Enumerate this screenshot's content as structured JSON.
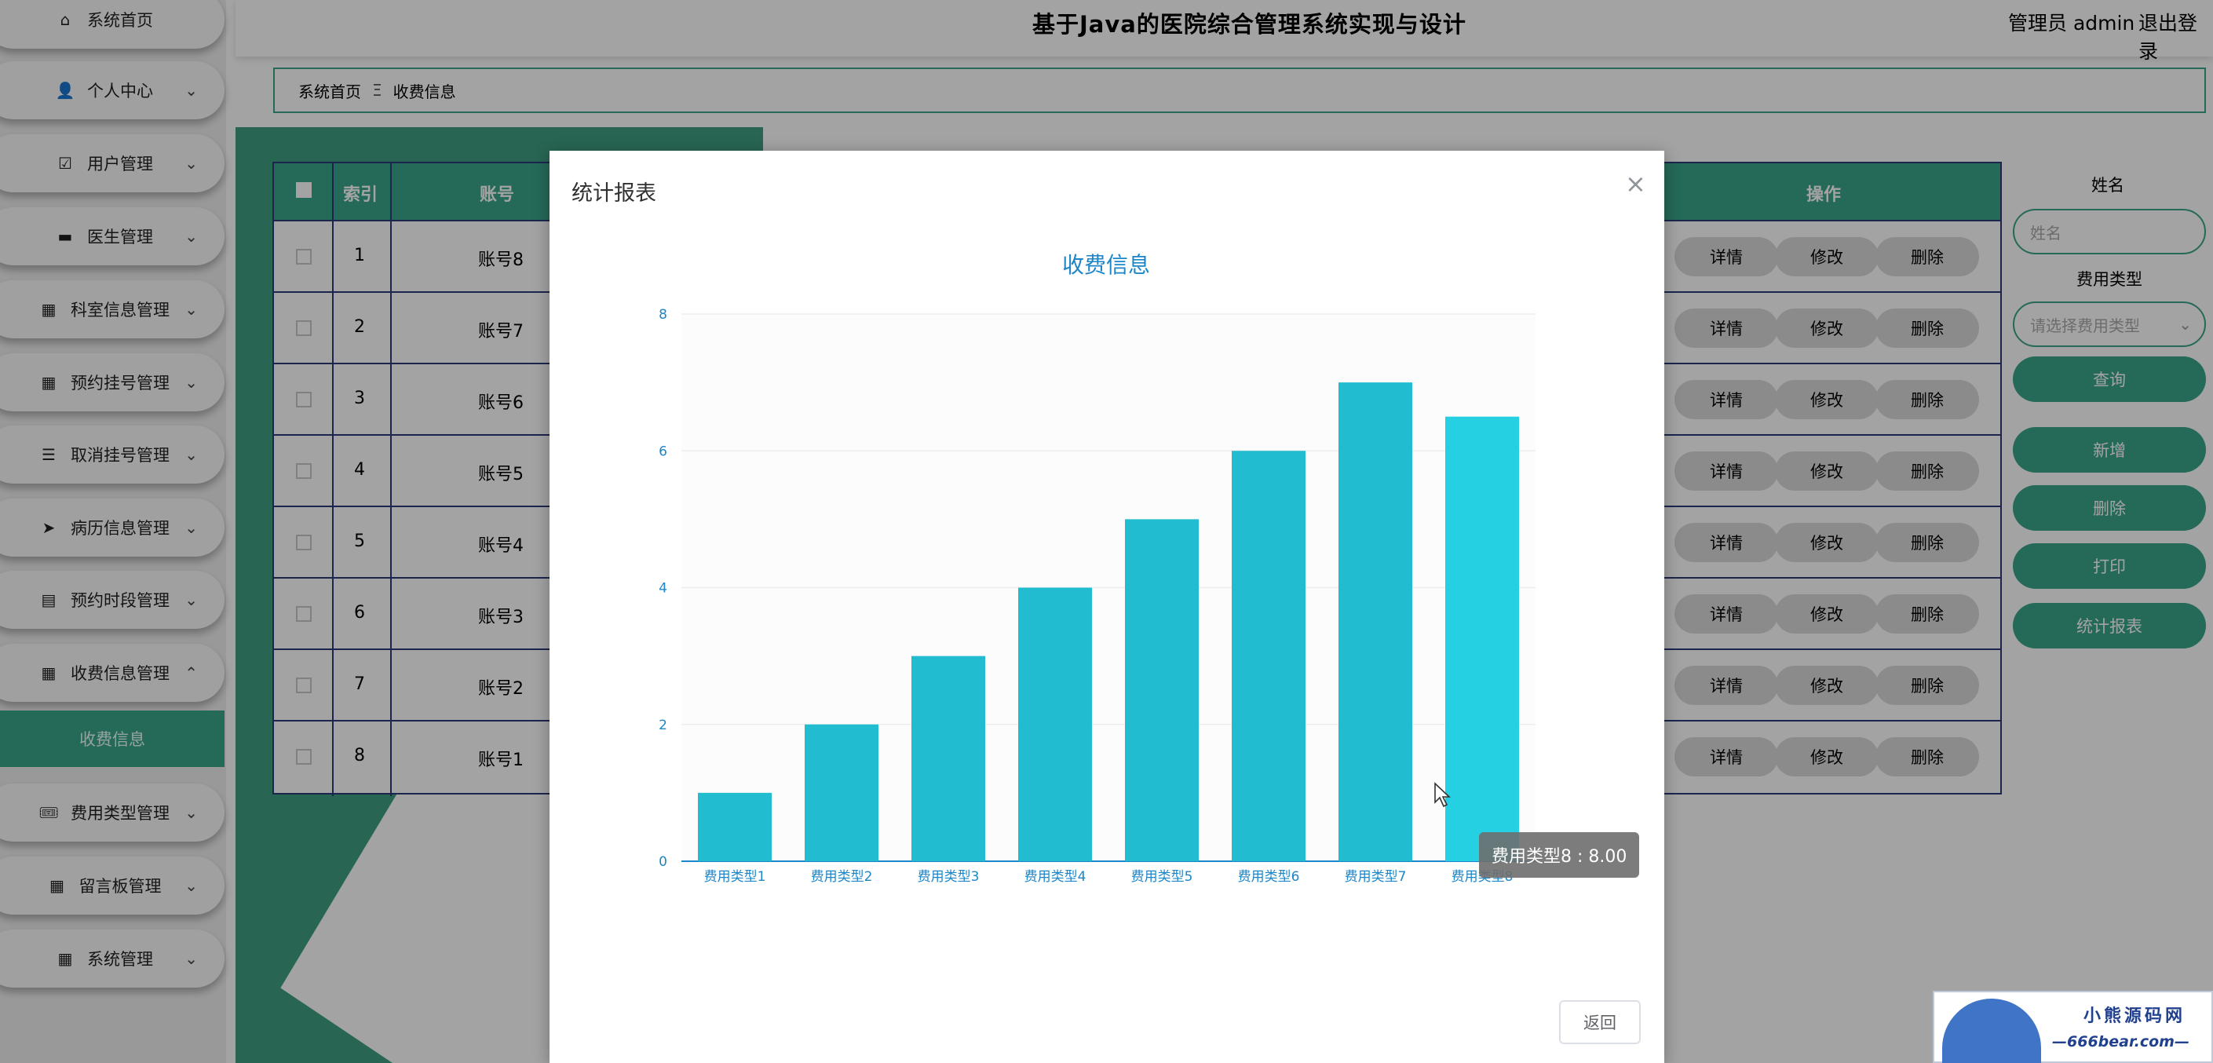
{
  "app": {
    "title": "基于Java的医院综合管理系统实现与设计",
    "user": "管理员 admin",
    "logout": "退出登录"
  },
  "sidebar": {
    "items": [
      {
        "label": "系统首页",
        "icon": "home-icon"
      },
      {
        "label": "个人中心",
        "icon": "user-icon"
      },
      {
        "label": "用户管理",
        "icon": "clipboard-check-icon"
      },
      {
        "label": "医生管理",
        "icon": "computer-icon"
      },
      {
        "label": "科室信息管理",
        "icon": "grid-icon"
      },
      {
        "label": "预约挂号管理",
        "icon": "grid-icon"
      },
      {
        "label": "取消挂号管理",
        "icon": "sliders-icon"
      },
      {
        "label": "病历信息管理",
        "icon": "paper-plane-icon"
      },
      {
        "label": "预约时段管理",
        "icon": "clipboard-icon"
      },
      {
        "label": "收费信息管理",
        "icon": "grid-icon"
      },
      {
        "label": "费用类型管理",
        "icon": "ticket-icon"
      },
      {
        "label": "留言板管理",
        "icon": "grid-icon"
      },
      {
        "label": "系统管理",
        "icon": "grid-icon"
      }
    ],
    "active_sub": "收费信息"
  },
  "breadcrumb": {
    "home": "系统首页",
    "separator": "Ξ",
    "current": "收费信息"
  },
  "table": {
    "headers": {
      "index": "索引",
      "account": "账号",
      "actions": "操作"
    },
    "rows": [
      {
        "index": "1",
        "account": "账号8"
      },
      {
        "index": "2",
        "account": "账号7"
      },
      {
        "index": "3",
        "account": "账号6"
      },
      {
        "index": "4",
        "account": "账号5"
      },
      {
        "index": "5",
        "account": "账号4"
      },
      {
        "index": "6",
        "account": "账号3"
      },
      {
        "index": "7",
        "account": "账号2"
      },
      {
        "index": "8",
        "account": "账号1"
      }
    ],
    "row_actions": {
      "detail": "详情",
      "edit": "修改",
      "delete": "删除"
    }
  },
  "search": {
    "name_label": "姓名",
    "name_placeholder": "姓名",
    "type_label": "费用类型",
    "type_placeholder": "请选择费用类型",
    "query": "查询",
    "add": "新增",
    "delete": "删除",
    "print": "打印",
    "stats": "统计报表"
  },
  "dialog": {
    "title": "统计报表",
    "close": "×",
    "back": "返回",
    "tooltip": "费用类型8 : 8.00"
  },
  "chart_data": {
    "type": "bar",
    "title": "收费信息",
    "categories": [
      "费用类型1",
      "费用类型2",
      "费用类型3",
      "费用类型4",
      "费用类型5",
      "费用类型6",
      "费用类型7",
      "费用类型8"
    ],
    "values": [
      1,
      2,
      3,
      4,
      5,
      6,
      7,
      6.5
    ],
    "ylim": [
      0,
      8
    ],
    "yticks": [
      0,
      2,
      4,
      6,
      8
    ],
    "grid": true,
    "colors": {
      "bar": "#22bcd0",
      "highlight": "#25d0e2",
      "axis": "#1c86c8"
    }
  },
  "watermark": {
    "text1": "小熊源码网",
    "text2": "—666bear.com—"
  },
  "colors": {
    "accent": "#3aa58b",
    "table_border": "#2d3a7a",
    "title_blue": "#1c86c8"
  }
}
